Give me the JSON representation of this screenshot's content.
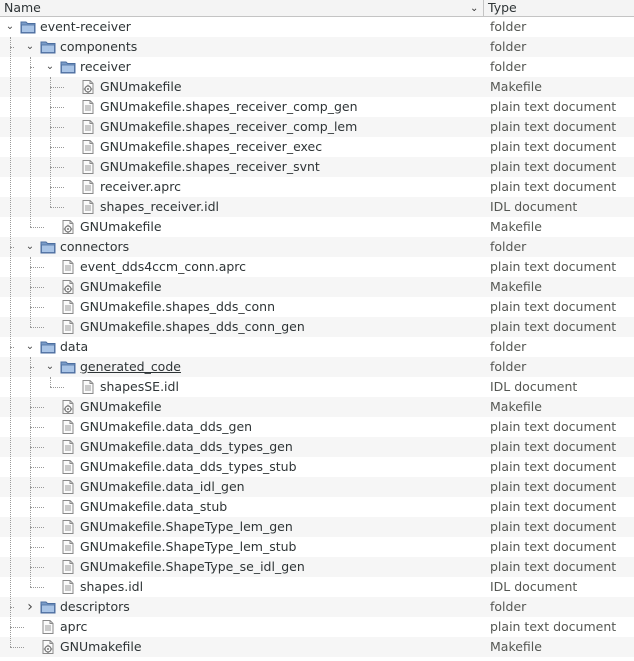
{
  "header": {
    "name_label": "Name",
    "type_label": "Type",
    "sort_icon": "chevron-down"
  },
  "rows": [
    {
      "label": "event-receiver",
      "type": "folder",
      "depth": 0,
      "kind": "folder",
      "expander": "open"
    },
    {
      "label": "components",
      "type": "folder",
      "depth": 1,
      "kind": "folder",
      "expander": "open"
    },
    {
      "label": "receiver",
      "type": "folder",
      "depth": 2,
      "kind": "folder",
      "expander": "open"
    },
    {
      "label": "GNUmakefile",
      "type": "Makefile",
      "depth": 3,
      "kind": "makefile"
    },
    {
      "label": "GNUmakefile.shapes_receiver_comp_gen",
      "type": "plain text document",
      "depth": 3,
      "kind": "text"
    },
    {
      "label": "GNUmakefile.shapes_receiver_comp_lem",
      "type": "plain text document",
      "depth": 3,
      "kind": "text"
    },
    {
      "label": "GNUmakefile.shapes_receiver_exec",
      "type": "plain text document",
      "depth": 3,
      "kind": "text"
    },
    {
      "label": "GNUmakefile.shapes_receiver_svnt",
      "type": "plain text document",
      "depth": 3,
      "kind": "text"
    },
    {
      "label": "receiver.aprc",
      "type": "plain text document",
      "depth": 3,
      "kind": "text"
    },
    {
      "label": "shapes_receiver.idl",
      "type": "IDL document",
      "depth": 3,
      "kind": "text"
    },
    {
      "label": "GNUmakefile",
      "type": "Makefile",
      "depth": 2,
      "kind": "makefile"
    },
    {
      "label": "connectors",
      "type": "folder",
      "depth": 1,
      "kind": "folder",
      "expander": "open"
    },
    {
      "label": "event_dds4ccm_conn.aprc",
      "type": "plain text document",
      "depth": 2,
      "kind": "text"
    },
    {
      "label": "GNUmakefile",
      "type": "Makefile",
      "depth": 2,
      "kind": "makefile"
    },
    {
      "label": "GNUmakefile.shapes_dds_conn",
      "type": "plain text document",
      "depth": 2,
      "kind": "text"
    },
    {
      "label": "GNUmakefile.shapes_dds_conn_gen",
      "type": "plain text document",
      "depth": 2,
      "kind": "text"
    },
    {
      "label": "data",
      "type": "folder",
      "depth": 1,
      "kind": "folder",
      "expander": "open"
    },
    {
      "label": "generated_code",
      "type": "folder",
      "depth": 2,
      "kind": "folder",
      "expander": "open",
      "underline": true
    },
    {
      "label": "shapesSE.idl",
      "type": "IDL document",
      "depth": 3,
      "kind": "text"
    },
    {
      "label": "GNUmakefile",
      "type": "Makefile",
      "depth": 2,
      "kind": "makefile"
    },
    {
      "label": "GNUmakefile.data_dds_gen",
      "type": "plain text document",
      "depth": 2,
      "kind": "text"
    },
    {
      "label": "GNUmakefile.data_dds_types_gen",
      "type": "plain text document",
      "depth": 2,
      "kind": "text"
    },
    {
      "label": "GNUmakefile.data_dds_types_stub",
      "type": "plain text document",
      "depth": 2,
      "kind": "text"
    },
    {
      "label": "GNUmakefile.data_idl_gen",
      "type": "plain text document",
      "depth": 2,
      "kind": "text"
    },
    {
      "label": "GNUmakefile.data_stub",
      "type": "plain text document",
      "depth": 2,
      "kind": "text"
    },
    {
      "label": "GNUmakefile.ShapeType_lem_gen",
      "type": "plain text document",
      "depth": 2,
      "kind": "text"
    },
    {
      "label": "GNUmakefile.ShapeType_lem_stub",
      "type": "plain text document",
      "depth": 2,
      "kind": "text"
    },
    {
      "label": "GNUmakefile.ShapeType_se_idl_gen",
      "type": "plain text document",
      "depth": 2,
      "kind": "text"
    },
    {
      "label": "shapes.idl",
      "type": "IDL document",
      "depth": 2,
      "kind": "text"
    },
    {
      "label": "descriptors",
      "type": "folder",
      "depth": 1,
      "kind": "folder",
      "expander": "closed"
    },
    {
      "label": "aprc",
      "type": "plain text document",
      "depth": 1,
      "kind": "text"
    },
    {
      "label": "GNUmakefile",
      "type": "Makefile",
      "depth": 1,
      "kind": "makefile"
    }
  ]
}
